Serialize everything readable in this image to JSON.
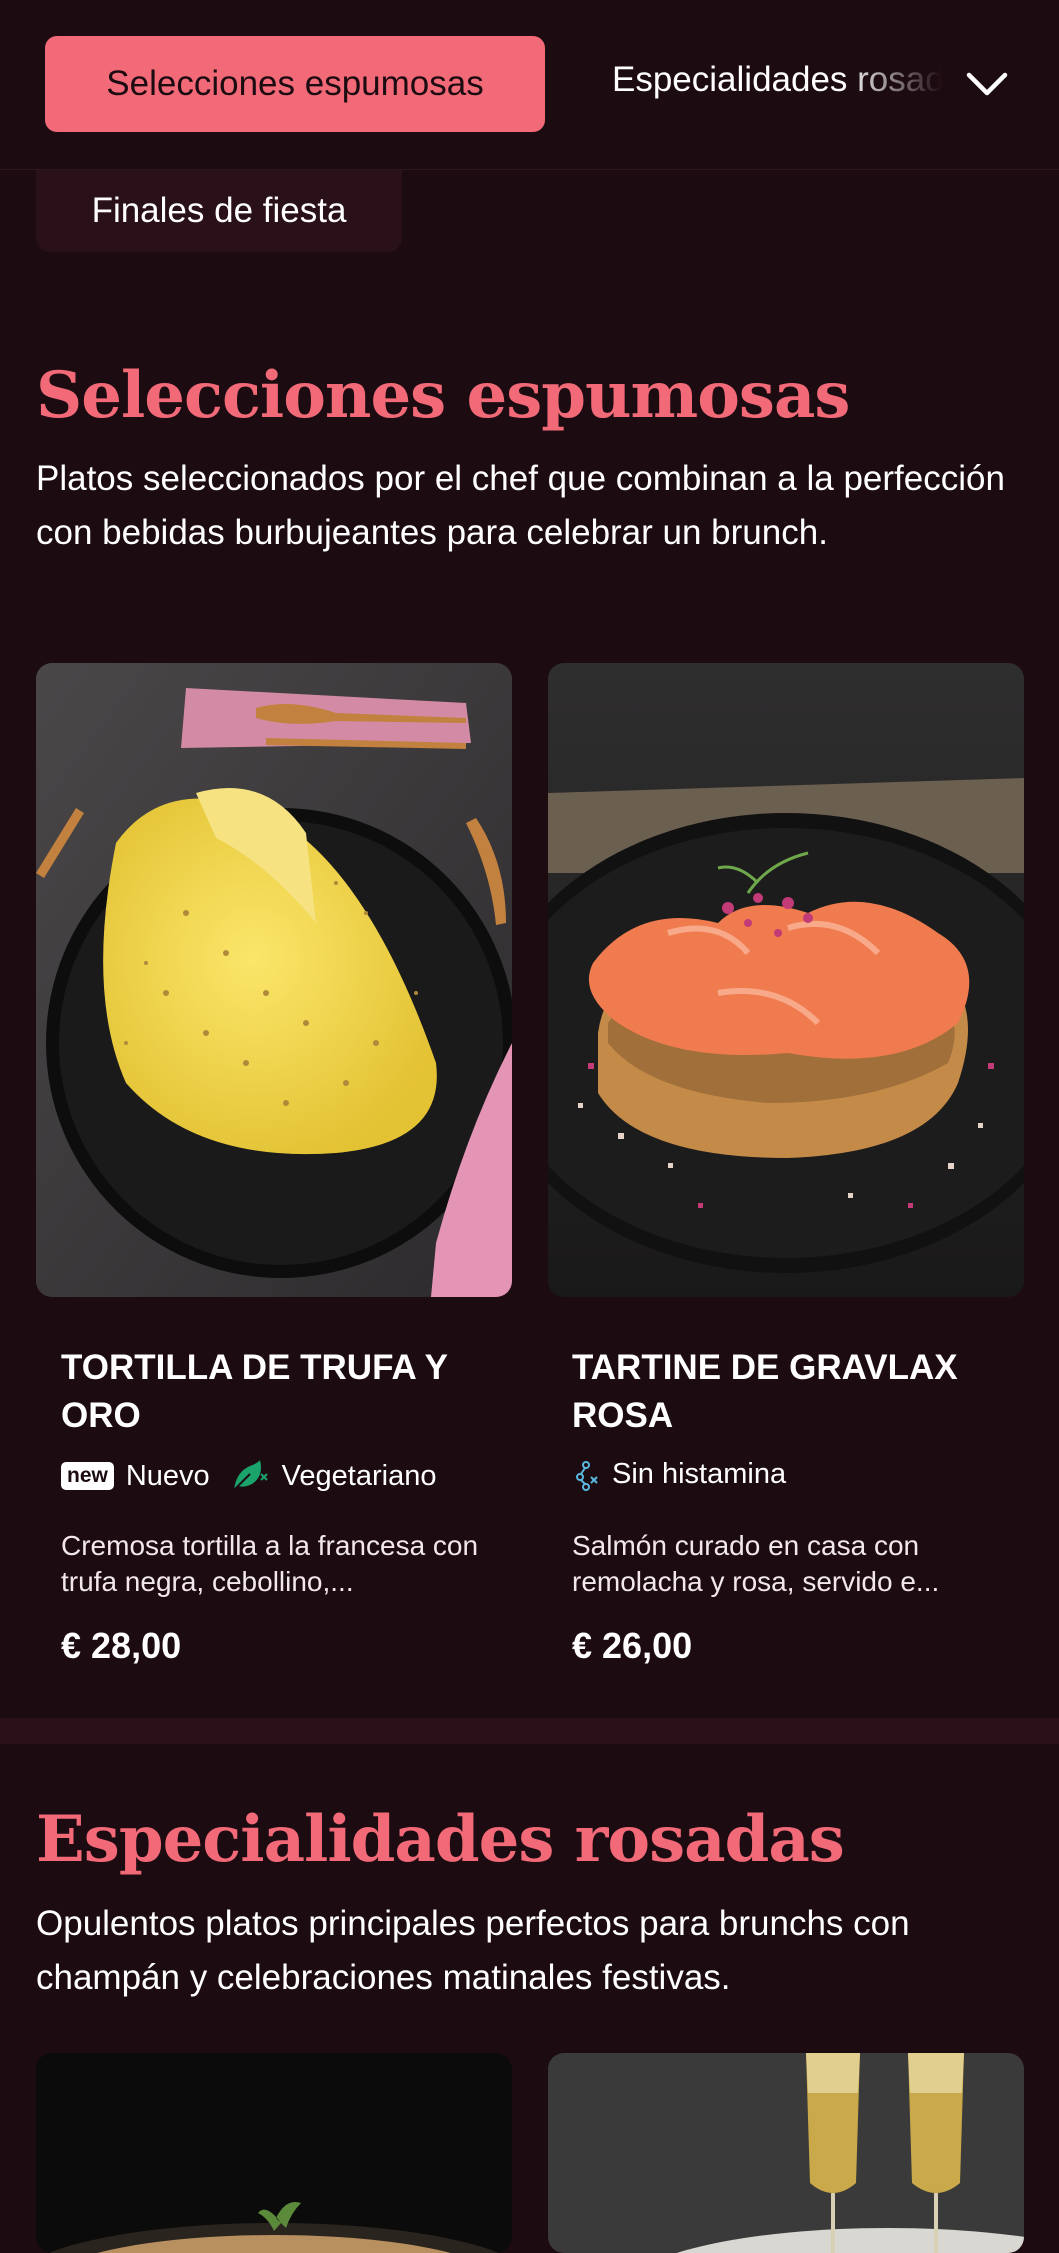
{
  "nav": {
    "active_tab": "Selecciones espumosas",
    "next_tab": "Especialidades rosadas",
    "chip": "Finales de fiesta"
  },
  "section1": {
    "title": "Selecciones espumosas",
    "description": "Platos seleccionados por el chef que combinan a la perfección con bebidas burbujeantes para celebrar un brunch.",
    "items": [
      {
        "name": "TORTILLA DE TRUFA Y ORO",
        "badge": "new",
        "tag1": "Nuevo",
        "tag2": "Vegetariano",
        "description": "Cremosa tortilla a la francesa con trufa negra, cebollino,...",
        "price": "€ 28,00"
      },
      {
        "name": "TARTINE DE GRAVLAX ROSA",
        "tag1": "Sin histamina",
        "description": "Salmón curado en casa con remolacha y rosa, servido e...",
        "price": "€ 26,00"
      }
    ]
  },
  "section2": {
    "title": "Especialidades rosadas",
    "description": "Opulentos platos principales perfectos para brunchs con champán y celebraciones matinales festivas."
  },
  "colors": {
    "background": "#1d0b12",
    "accent": "#f26a78",
    "card": "#2a1119",
    "vegetarian": "#1aa36b",
    "histamine": "#5ab8e0"
  },
  "icons": {
    "chevron": "chevron-down-icon",
    "vegetarian": "leaf-icon",
    "histamine": "molecule-icon"
  }
}
